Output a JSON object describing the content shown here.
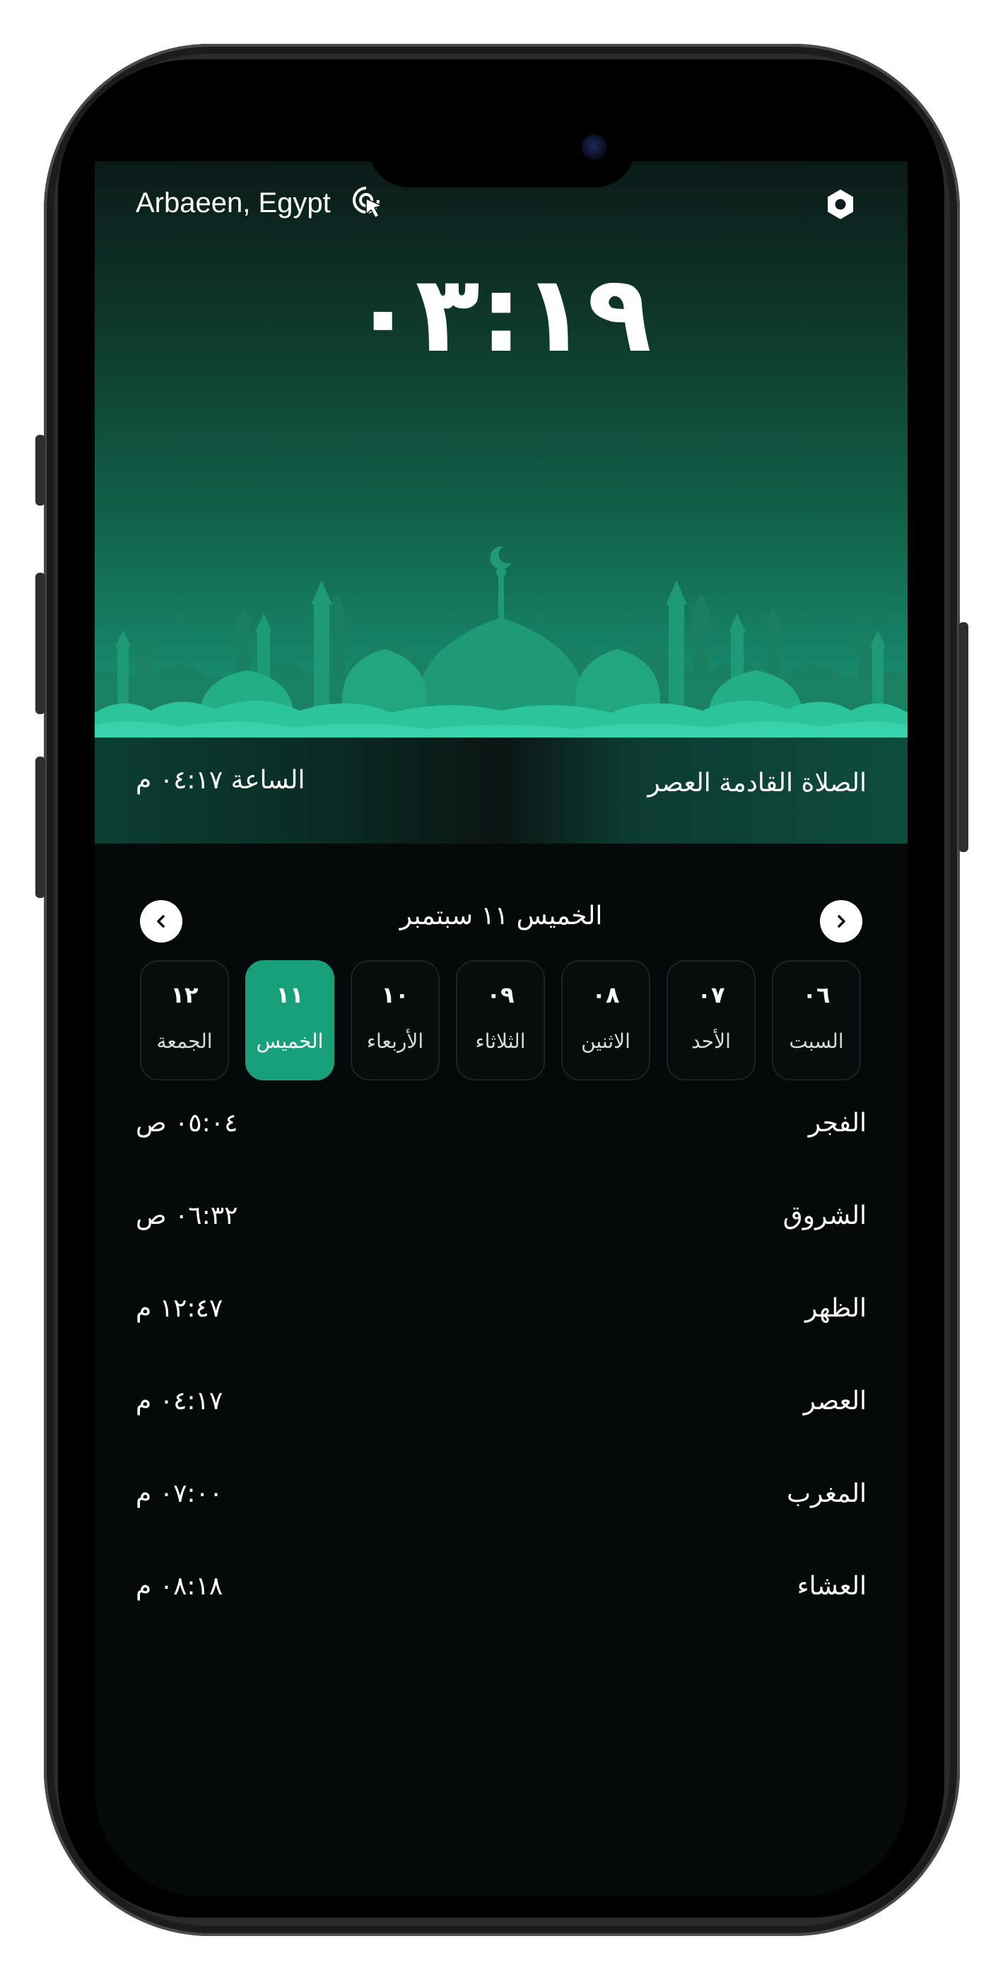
{
  "header": {
    "location": "Arbaeen, Egypt",
    "clock": "٠٣:١٩"
  },
  "next_prayer": {
    "label": "الصلاة القادمة العصر",
    "time": "الساعة ٠٤:١٧ م"
  },
  "date_nav": {
    "title": "الخميس ١١ سبتمبر"
  },
  "days": [
    {
      "num": "١٢",
      "name": "الجمعة",
      "active": false
    },
    {
      "num": "١١",
      "name": "الخميس",
      "active": true
    },
    {
      "num": "١٠",
      "name": "الأربعاء",
      "active": false
    },
    {
      "num": "٠٩",
      "name": "الثلاثاء",
      "active": false
    },
    {
      "num": "٠٨",
      "name": "الاثنين",
      "active": false
    },
    {
      "num": "٠٧",
      "name": "الأحد",
      "active": false
    },
    {
      "num": "٠٦",
      "name": "السبت",
      "active": false
    }
  ],
  "prayers": [
    {
      "name": "الفجر",
      "time": "٠٥:٠٤ ص"
    },
    {
      "name": "الشروق",
      "time": "٠٦:٣٢ ص"
    },
    {
      "name": "الظهر",
      "time": "١٢:٤٧ م"
    },
    {
      "name": "العصر",
      "time": "٠٤:١٧ م"
    },
    {
      "name": "المغرب",
      "time": "٠٧:٠٠ م"
    },
    {
      "name": "العشاء",
      "time": "٠٨:١٨ م"
    }
  ],
  "colors": {
    "accent": "#17a07a",
    "background": "#05090a"
  },
  "icons": {
    "location": "location-cursor-icon",
    "settings": "settings-gear-icon",
    "prev": "chevron-left-icon",
    "next": "chevron-right-icon"
  }
}
